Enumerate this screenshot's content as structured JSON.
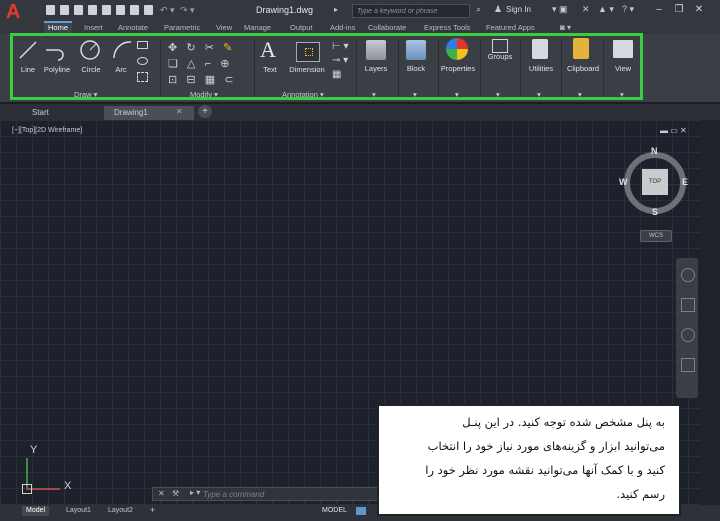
{
  "window": {
    "app_logo": "A",
    "document_title": "Drawing1.dwg",
    "search_placeholder": "Type a keyword or phrase",
    "sign_in": "Sign In"
  },
  "ribbon_tabs": [
    "Home",
    "Insert",
    "Annotate",
    "Parametric",
    "View",
    "Manage",
    "Output",
    "Add-ins",
    "Collaborate",
    "Express Tools",
    "Featured Apps"
  ],
  "ribbon": {
    "draw": {
      "line": "Line",
      "polyline": "Polyline",
      "circle": "Circle",
      "arc": "Arc",
      "group_label": "Draw ▾"
    },
    "modify": {
      "group_label": "Modify ▾"
    },
    "annotation": {
      "text": "Text",
      "dimension": "Dimension",
      "group_label": "Annotation ▾"
    },
    "layers": "Layers",
    "block": "Block",
    "properties": "Properties",
    "groups": "Groups",
    "utilities": "Utilities",
    "clipboard": "Clipboard",
    "view": "View"
  },
  "file_tabs": [
    "Start",
    "Drawing1"
  ],
  "viewport": {
    "label": "[−][Top][2D Wireframe]",
    "controls": "▬ ▭ ✕",
    "compass": {
      "n": "N",
      "s": "S",
      "e": "E",
      "w": "W",
      "cube_face": "TOP",
      "wcs": "WCS"
    }
  },
  "ucs": {
    "x": "X",
    "y": "Y"
  },
  "command": {
    "placeholder": "Type a command"
  },
  "status": {
    "tabs": [
      "Model",
      "Layout1",
      "Layout2"
    ],
    "mode": "MODEL"
  },
  "note": {
    "lines": [
      "به پنل مشخص شده توجه کنید. در این پنـل",
      "می‌توانید ابزار و گزینه‌های مورد نیاز خود را انتخاب",
      "کنید و با کمک آنها می‌توانید نقشه مورد نظر خود را",
      "رسم کنید."
    ]
  },
  "colors": {
    "highlight": "#39d03f",
    "logo": "#e23b2e",
    "note_bg": "#ffffff"
  }
}
